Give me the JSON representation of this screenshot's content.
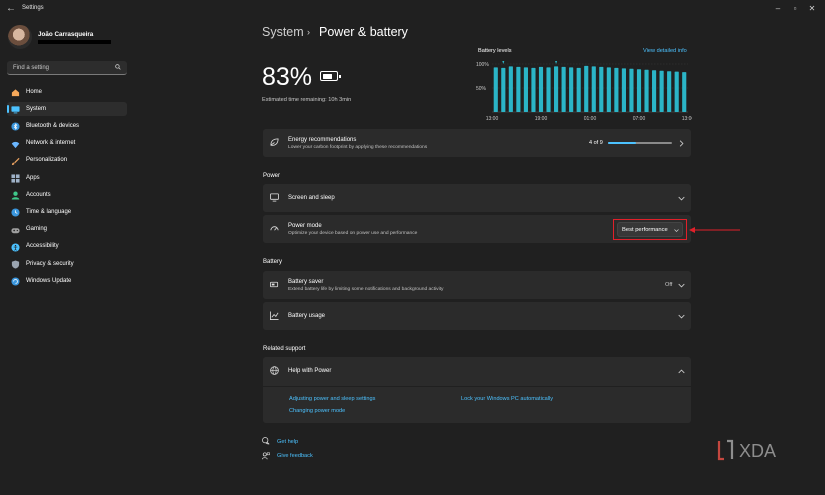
{
  "window": {
    "title": "Settings"
  },
  "user": {
    "name": "João Carrasqueira"
  },
  "search": {
    "placeholder": "Find a setting"
  },
  "sidebar": {
    "items": [
      {
        "label": "Home",
        "icon": "home-icon",
        "color": "#f5a85a"
      },
      {
        "label": "System",
        "icon": "system-icon",
        "color": "#4cc2ff",
        "selected": true
      },
      {
        "label": "Bluetooth & devices",
        "icon": "bluetooth-icon",
        "color": "#3a96dd"
      },
      {
        "label": "Network & internet",
        "icon": "network-icon",
        "color": "#6ab6ff"
      },
      {
        "label": "Personalization",
        "icon": "brush-icon",
        "color": "#e8a060"
      },
      {
        "label": "Apps",
        "icon": "apps-icon",
        "color": "#9fb2c8"
      },
      {
        "label": "Accounts",
        "icon": "accounts-icon",
        "color": "#3fc78a"
      },
      {
        "label": "Time & language",
        "icon": "globe-clock-icon",
        "color": "#3a96dd"
      },
      {
        "label": "Gaming",
        "icon": "gamepad-icon",
        "color": "#a0a0a0"
      },
      {
        "label": "Accessibility",
        "icon": "accessibility-icon",
        "color": "#4cc2ff"
      },
      {
        "label": "Privacy & security",
        "icon": "shield-icon",
        "color": "#9aa4b0"
      },
      {
        "label": "Windows Update",
        "icon": "windows-update-icon",
        "color": "#3a96dd"
      }
    ]
  },
  "breadcrumb": {
    "parent": "System",
    "separator": "›",
    "current": "Power & battery"
  },
  "battery": {
    "percent": "83%",
    "level": 0.83,
    "estimate": "Estimated time remaining: 10h 3min"
  },
  "levels": {
    "title": "Battery levels",
    "link": "View detailed info",
    "yticks": [
      "100%",
      "50%"
    ],
    "xticks": [
      "13:00",
      "19:00",
      "01:00",
      "07:00",
      "13:00"
    ],
    "bar_color": "#2bb5c7"
  },
  "chart_data": {
    "type": "bar",
    "title": "Battery levels",
    "ylim": [
      0,
      100
    ],
    "x_ticks": [
      "13:00",
      "19:00",
      "01:00",
      "07:00",
      "13:00"
    ],
    "values": [
      93,
      92,
      95,
      94,
      93,
      92,
      94,
      93,
      95,
      94,
      93,
      92,
      96,
      95,
      94,
      93,
      92,
      91,
      90,
      89,
      88,
      87,
      86,
      85,
      84,
      83
    ],
    "color": "#2bb5c7"
  },
  "energy": {
    "title": "Energy recommendations",
    "subtitle": "Lower your carbon footprint by applying these recommendations",
    "count": "4 of 9",
    "progress": 0.44
  },
  "sections": {
    "power": "Power",
    "battery": "Battery",
    "related": "Related support"
  },
  "power": {
    "screen_sleep": "Screen and sleep",
    "mode_title": "Power mode",
    "mode_subtitle": "Optimize your device based on power use and performance",
    "mode_value": "Best performance"
  },
  "battery_section": {
    "saver_title": "Battery saver",
    "saver_subtitle": "Extend battery life by limiting some notifications and background activity",
    "saver_value": "Off",
    "usage_title": "Battery usage"
  },
  "related": {
    "help_title": "Help with Power",
    "links": [
      "Adjusting power and sleep settings",
      "Lock your Windows PC automatically",
      "Changing power mode"
    ]
  },
  "footer": {
    "get_help": "Get help",
    "feedback": "Give feedback"
  },
  "watermark": {
    "text": "XDA"
  }
}
